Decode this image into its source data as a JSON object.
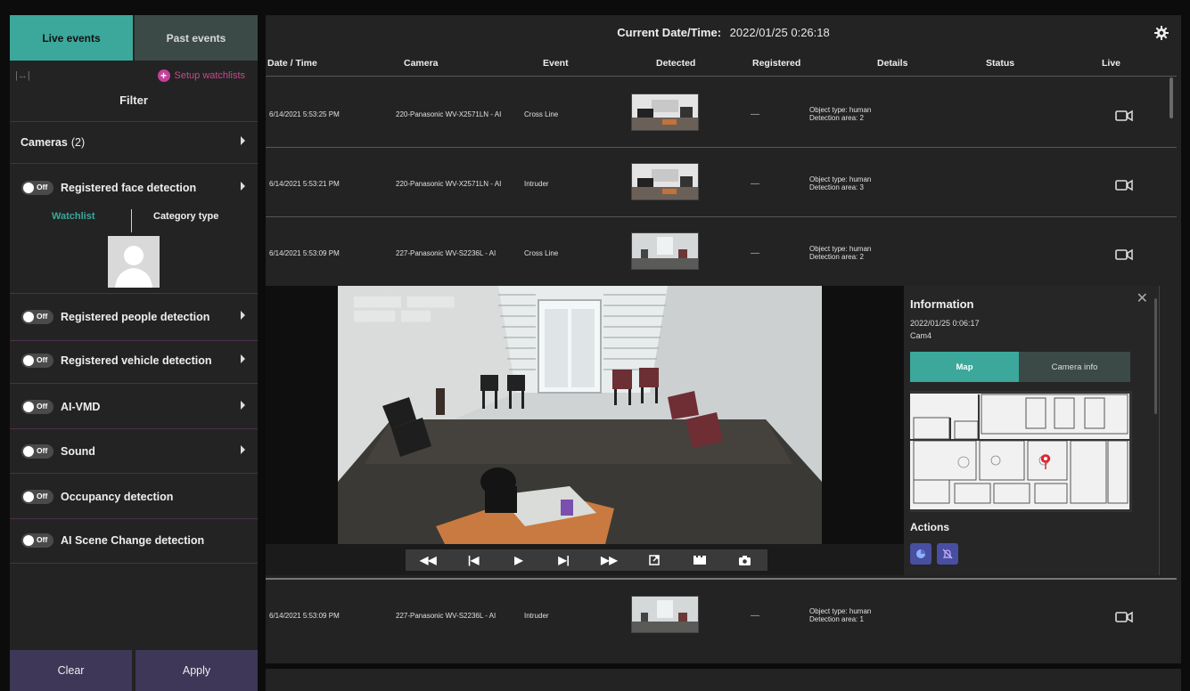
{
  "sidebar": {
    "tabs": [
      {
        "label": "Live events"
      },
      {
        "label": "Past events"
      }
    ],
    "setup_watchlists": "Setup watchlists",
    "filter_title": "Filter",
    "cameras": {
      "label": "Cameras",
      "count": "(2)"
    },
    "toggle_off_label": "Off",
    "filters": [
      {
        "label": "Registered face detection"
      },
      {
        "label": "Registered people detection"
      },
      {
        "label": "Registered vehicle detection"
      },
      {
        "label": "AI-VMD"
      },
      {
        "label": "Sound"
      },
      {
        "label": "Occupancy detection"
      },
      {
        "label": "AI Scene Change detection"
      }
    ],
    "subtabs": {
      "watchlist": "Watchlist",
      "category": "Category type"
    },
    "clear_label": "Clear",
    "apply_label": "Apply"
  },
  "header": {
    "label": "Current Date/Time:",
    "value": "2022/01/25 0:26:18"
  },
  "columns": [
    "Date / Time",
    "Camera",
    "Event",
    "Detected",
    "Registered",
    "Details",
    "Status",
    "Live"
  ],
  "rows": [
    {
      "datetime": "6/14/2021 5:53:25 PM",
      "camera": "220-Panasonic WV-X2571LN - AI",
      "event": "Cross Line",
      "registered": "—",
      "details_1": "Object type: human",
      "details_2": "Detection area: 2"
    },
    {
      "datetime": "6/14/2021 5:53:21 PM",
      "camera": "220-Panasonic WV-X2571LN - AI",
      "event": "Intruder",
      "registered": "—",
      "details_1": "Object type: human",
      "details_2": "Detection area: 3"
    },
    {
      "datetime": "6/14/2021 5:53:09 PM",
      "camera": "227-Panasonic WV-S2236L - AI",
      "event": "Cross Line",
      "registered": "—",
      "details_1": "Object type: human",
      "details_2": "Detection area: 2"
    },
    {
      "datetime": "6/14/2021 5:53:09 PM",
      "camera": "227-Panasonic WV-S2236L - AI",
      "event": "Intruder",
      "registered": "—",
      "details_1": "Object type: human",
      "details_2": "Detection area: 1"
    }
  ],
  "info": {
    "title": "Information",
    "date": "2022/01/25 0:06:17",
    "camera": "Cam4",
    "tab_map": "Map",
    "tab_camera_info": "Camera info",
    "actions": "Actions"
  },
  "colors": {
    "accent": "#3ba89b",
    "button": "#3e3758",
    "setup": "#c2419a",
    "action": "#484fa0"
  }
}
